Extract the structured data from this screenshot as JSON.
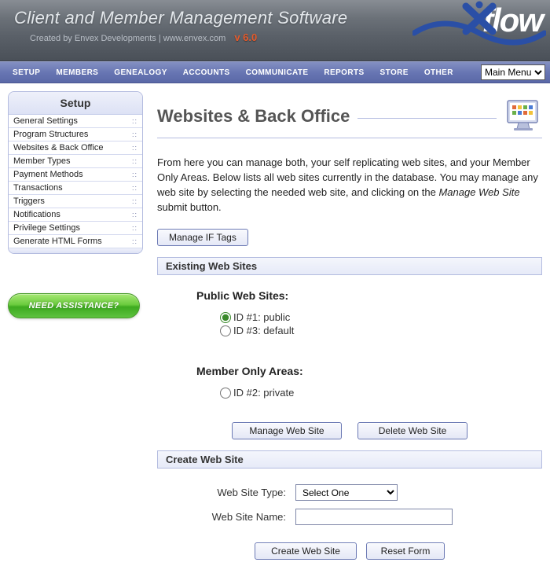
{
  "header": {
    "title": "Client and Member Management Software",
    "subtitle": "Created by Envex Developments  |  www.envex.com",
    "version": "v 6.0",
    "logo_text": "flow"
  },
  "nav": {
    "items": [
      "SETUP",
      "MEMBERS",
      "GENEALOGY",
      "ACCOUNTS",
      "COMMUNICATE",
      "REPORTS",
      "STORE",
      "OTHER"
    ],
    "main_menu_label": "Main Menu"
  },
  "sidebar": {
    "title": "Setup",
    "items": [
      {
        "label": "General Settings"
      },
      {
        "label": "Program Structures"
      },
      {
        "label": "Websites & Back Office"
      },
      {
        "label": "Member Types"
      },
      {
        "label": "Payment Methods"
      },
      {
        "label": "Transactions"
      },
      {
        "label": "Triggers"
      },
      {
        "label": "Notifications"
      },
      {
        "label": "Privilege Settings"
      },
      {
        "label": "Generate HTML Forms"
      }
    ],
    "assist_label": "NEED ASSISTANCE?"
  },
  "page": {
    "title": "Websites & Back Office",
    "intro_1": "From here you can manage both, your self replicating web sites, and your Member Only Areas. Below lists all web sites currently in the database. You may manage any web site by selecting the needed web site, and clicking on the ",
    "intro_em": "Manage Web Site",
    "intro_2": " submit button.",
    "btn_manage_if": "Manage IF Tags",
    "section_existing": "Existing Web Sites",
    "public_head": "Public Web Sites:",
    "public_sites": [
      {
        "id": "opt1",
        "label": "ID #1: public",
        "checked": true
      },
      {
        "id": "opt3",
        "label": "ID #3: default",
        "checked": false
      }
    ],
    "member_head": "Member Only Areas:",
    "member_sites": [
      {
        "id": "opt2",
        "label": "ID #2: private",
        "checked": false
      }
    ],
    "btn_manage": "Manage Web Site",
    "btn_delete": "Delete Web Site",
    "section_create": "Create Web Site",
    "form": {
      "type_label": "Web Site Type:",
      "type_selected": "Select One",
      "name_label": "Web Site Name:",
      "name_value": ""
    },
    "btn_create": "Create Web Site",
    "btn_reset": "Reset Form"
  }
}
